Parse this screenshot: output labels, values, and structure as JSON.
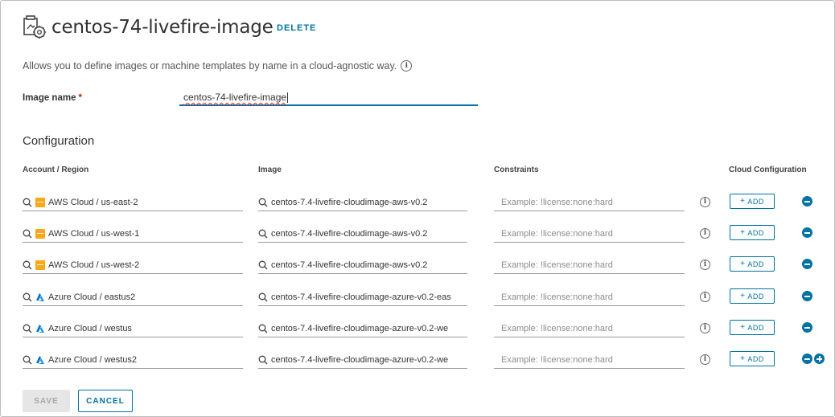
{
  "header": {
    "title": "centos-74-livefire-image",
    "title_icon": "image-settings-icon",
    "delete_label": "DELETE"
  },
  "description": "Allows you to define images or machine templates by name in a cloud-agnostic way.",
  "image_name": {
    "label": "Image name",
    "required_mark": "*",
    "value": "centos-74-livefire-image"
  },
  "configuration": {
    "title": "Configuration",
    "columns": [
      "Account / Region",
      "Image",
      "Constraints",
      "Cloud Configuration"
    ],
    "add_label": "ADD",
    "rows": [
      {
        "provider": "aws",
        "account": "AWS Cloud / us-east-2",
        "image": "centos-7.4-livefire-cloudimage-aws-v0.2",
        "constraint_placeholder": "Example: !license:none:hard"
      },
      {
        "provider": "aws",
        "account": "AWS Cloud / us-west-1",
        "image": "centos-7.4-livefire-cloudimage-aws-v0.2",
        "constraint_placeholder": "Example: !license:none:hard"
      },
      {
        "provider": "aws",
        "account": "AWS Cloud / us-west-2",
        "image": "centos-7.4-livefire-cloudimage-aws-v0.2",
        "constraint_placeholder": "Example: !license:none:hard"
      },
      {
        "provider": "azure",
        "account": "Azure Cloud / eastus2",
        "image": "centos-7.4-livefire-cloudimage-azure-v0.2-eas",
        "constraint_placeholder": "Example: !license:none:hard"
      },
      {
        "provider": "azure",
        "account": "Azure Cloud / westus",
        "image": "centos-7.4-livefire-cloudimage-azure-v0.2-we",
        "constraint_placeholder": "Example: !license:none:hard"
      },
      {
        "provider": "azure",
        "account": "Azure Cloud / westus2",
        "image": "centos-7.4-livefire-cloudimage-azure-v0.2-we",
        "constraint_placeholder": "Example: !license:none:hard"
      }
    ]
  },
  "footer": {
    "save_label": "SAVE",
    "cancel_label": "CANCEL"
  },
  "colors": {
    "accent": "#0072a3",
    "aws": "#f7a81b",
    "azure": "#0072c6"
  }
}
